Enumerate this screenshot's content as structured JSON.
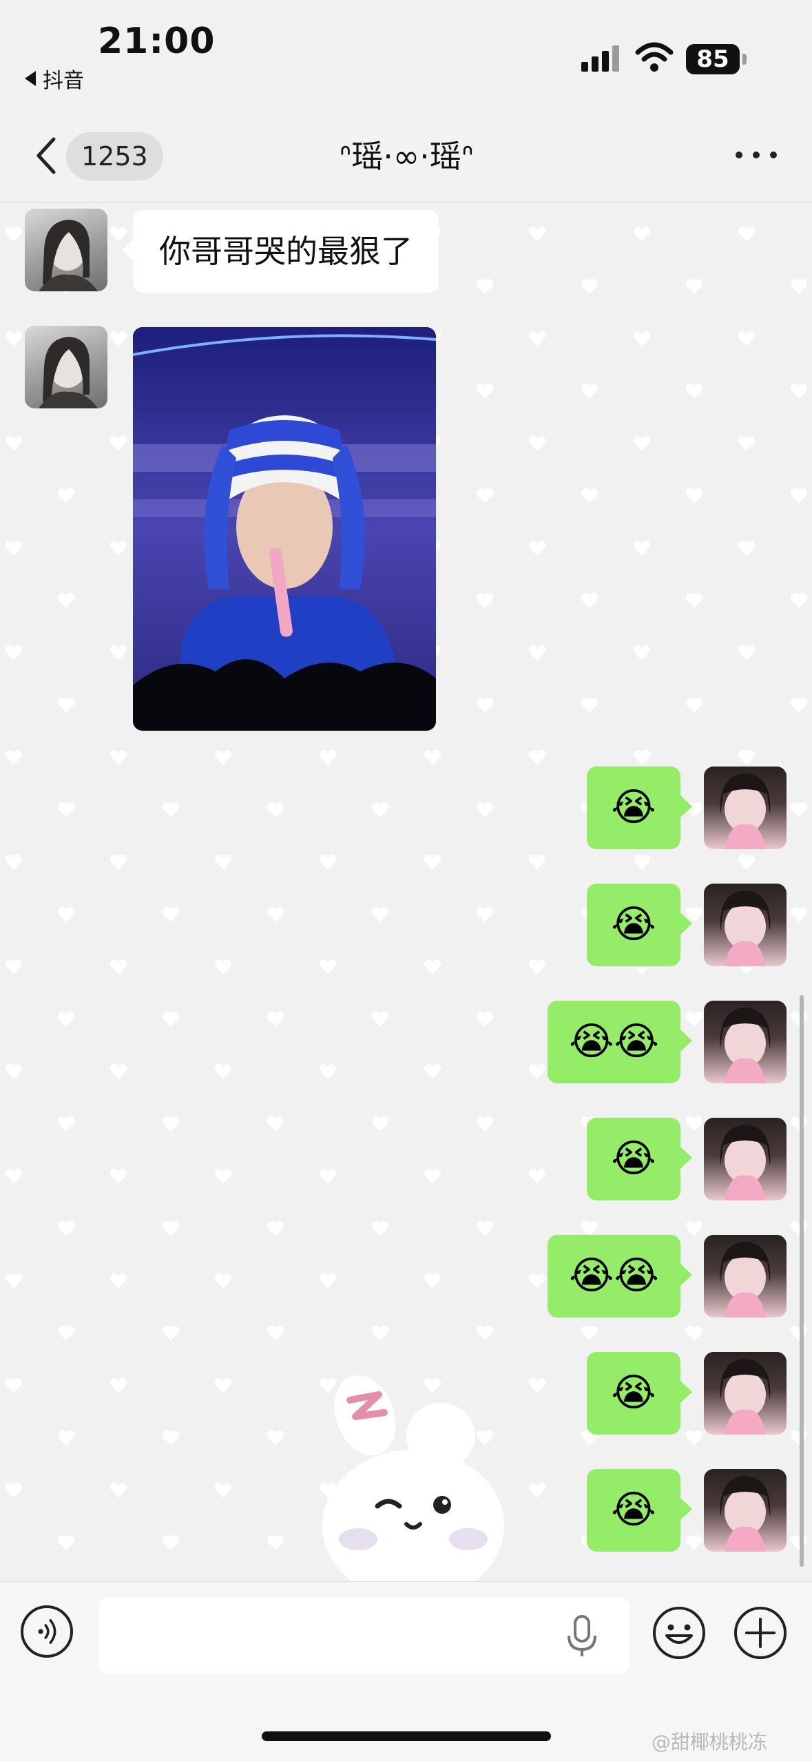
{
  "status_bar": {
    "time": "21:00",
    "back_app": "抖音",
    "battery": "85"
  },
  "nav": {
    "unread_count": "1253",
    "title": "ᐢ瑶·∞·瑶ᐢ"
  },
  "messages": [
    {
      "side": "left",
      "type": "text",
      "text": "你哥哥哭的最狠了"
    },
    {
      "side": "left",
      "type": "image"
    },
    {
      "side": "right",
      "type": "emoji",
      "text": "😭"
    },
    {
      "side": "right",
      "type": "emoji",
      "text": "😭"
    },
    {
      "side": "right",
      "type": "emoji",
      "text": "😭😭"
    },
    {
      "side": "right",
      "type": "emoji",
      "text": "😭"
    },
    {
      "side": "right",
      "type": "emoji",
      "text": "😭😭"
    },
    {
      "side": "right",
      "type": "emoji",
      "text": "😭"
    },
    {
      "side": "right",
      "type": "emoji",
      "text": "😭"
    }
  ],
  "input": {
    "value": "",
    "placeholder": ""
  },
  "watermark": "@甜椰桃桃冻",
  "colors": {
    "bubble_mine": "#95ec69",
    "bubble_theirs": "#ffffff",
    "background": "#f1f1f1"
  },
  "icons": [
    "back-chevron-icon",
    "more-icon",
    "voice-icon",
    "mic-icon",
    "emoji-icon",
    "plus-icon",
    "signal-icon",
    "wifi-icon",
    "battery-icon"
  ]
}
